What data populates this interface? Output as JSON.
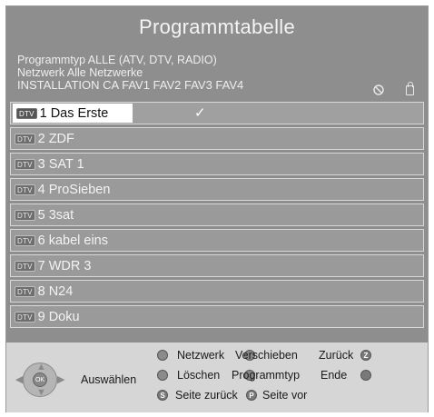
{
  "title": "Programmtabelle",
  "info": {
    "line1": "Programmtyp ALLE (ATV, DTV, RADIO)",
    "line2": "Netzwerk Alle Netzwerke",
    "line3": "INSTALLATION CA FAV1 FAV2 FAV3 FAV4"
  },
  "icons": {
    "ban": "⃠",
    "ban_name": "no-entry-icon",
    "lock_name": "lock-icon"
  },
  "channels": [
    {
      "badge": "DTV",
      "label": "1 Das Erste",
      "selected": true
    },
    {
      "badge": "DTV",
      "label": "2 ZDF"
    },
    {
      "badge": "DTV",
      "label": "3 SAT 1"
    },
    {
      "badge": "DTV",
      "label": "4 ProSieben"
    },
    {
      "badge": "DTV",
      "label": "5 3sat"
    },
    {
      "badge": "DTV",
      "label": "6 kabel eins"
    },
    {
      "badge": "DTV",
      "label": "7 WDR 3"
    },
    {
      "badge": "DTV",
      "label": "8 N24"
    },
    {
      "badge": "DTV",
      "label": "9 Doku"
    }
  ],
  "check_mark": "✓",
  "footer": {
    "select_label": "Auswählen",
    "netzwerk": "Netzwerk",
    "verschieben": "Verschieben",
    "zurueck": "Zurück",
    "loeschen": "Löschen",
    "programmtyp": "Programmtyp",
    "ende": "Ende",
    "seite_zurueck": "Seite zurück",
    "seite_vor": "Seite vor",
    "btn_z": "Z",
    "btn_s": "S",
    "btn_p": "P",
    "ok": "OK"
  }
}
